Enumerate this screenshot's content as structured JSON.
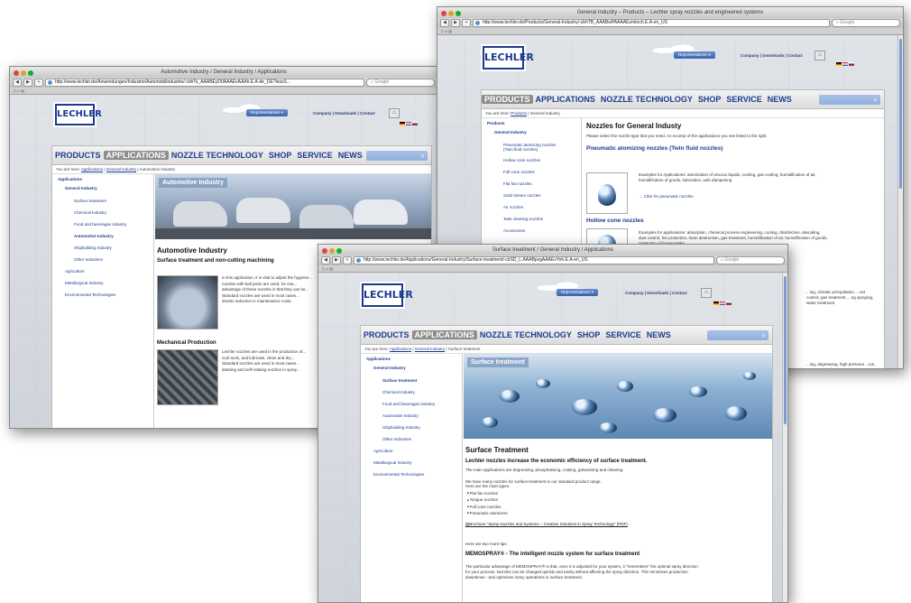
{
  "colors": {
    "brand": "#1c3b8f",
    "nav_active": "#8d8d8d",
    "search": "#9db8e2"
  },
  "icons": {
    "globe": "globe-icon",
    "home": "home-icon",
    "search": "search-icon",
    "back": "back-arrow-icon",
    "forward": "forward-arrow-icon",
    "scroll": "scrollbar"
  },
  "windows": {
    "automotive": {
      "title": "Automotive Industry / General Industry / Applications",
      "url": "http://www.lechler.de/Anwendungen/Industrie/Automobilindustrie/-cbhTs_AAABEyD0AAAEvAAAh.E.A-de_DE?lessS…",
      "google": "Google",
      "logo": "LECHLER",
      "reps": "Representatives",
      "toplinks": "Company | Downloads | Contact",
      "nav": [
        "PRODUCTS",
        "APPLICATIONS",
        "NOZZLE TECHNOLOGY",
        "SHOP",
        "SERVICE",
        "NEWS"
      ],
      "crumb_prefix": "You are here:",
      "crumb": [
        "Applications",
        "General Industry",
        "Automotive Industry"
      ],
      "side": [
        "Applications",
        "General Industry",
        "Surface treatment",
        "Chemical Industry",
        "Food and beverages industry",
        "Automotive Industry",
        "Shipbuilding Industry",
        "Other Industries",
        "Agriculture",
        "Metallurgical Industry",
        "Environmental Technologies"
      ],
      "banner": "Automotive Industry",
      "heading": "Automotive Industry",
      "sub1": "Surface treatment and non-cutting machining",
      "text1a": "In this application, it is vital to adjust the hygiene...",
      "text1b": "nozzles with ball joints are used, for exa...",
      "text1c": "advantage of these nozzles is that they can be...",
      "text1d": "Standard nozzles are used in most cases...",
      "text1e": "drastic reduction in maintenance costs.",
      "sub2": "Mechanical Production",
      "text2a": "Lechler nozzles are used in the production of...",
      "text2b": "cool tools, and lubricate, clean and dry...",
      "text2c": "Standard nozzles are used in most cases...",
      "text2d": "draining and self-rotating nozzles in spray..."
    },
    "products": {
      "title": "General Industry – Products – Lechler spray nozzles and engineered systems",
      "url": "http://www.lechler.de/Products/General-Industry/-cbhTB_AAABwPAAAAEzmtoch.E.A-en_US",
      "google": "Google",
      "logo": "LECHLER",
      "reps": "Representatives",
      "toplinks": "Company | Downloads | Contact",
      "nav": [
        "PRODUCTS",
        "APPLICATIONS",
        "NOZZLE TECHNOLOGY",
        "SHOP",
        "SERVICE",
        "NEWS"
      ],
      "crumb_prefix": "You are here:",
      "crumb": [
        "Products",
        "General Industry"
      ],
      "side": [
        "Products",
        "General Industry",
        "Pneumatic atomizing nozzles (Twin fluid nozzles)",
        "Hollow cone nozzles",
        "Full cone nozzles",
        "Flat fan nozzles",
        "Solid stream nozzles",
        "Air nozzles",
        "Tank cleaning nozzles",
        "Accessories"
      ],
      "heading": "Nozzles for General Industy",
      "intro": "Please select the nozzle type that you need. An excerpt of the applications you see listed to the right.",
      "sec1": "Pneumatic atomizing nozzles (Twin fluid nozzles)",
      "sec1_text": "Examples for Applications: atomization of viscous liquids, cooling, gas cooling, humidification of air, humidification of goods, lubrication, web dampening",
      "sec1_link": "Click for pneumatic nozzles",
      "sec2": "Hollow cone nozzles",
      "sec2_text": "Examples for applications: absorption, chemical process engineering, cooling, disinfection, descaling, dust control, fire protection, foam destruction, gas treatment, humidification of air, humidification of goods, protection of forage tanks...",
      "sec3_text": "...ing, climatic precipitation, ...ust control, gas treatment, ...ng spraying, water treatment",
      "sec4_text": "...ing, degreasing, high pressure ...ion, sun screens, foam control,"
    },
    "surface": {
      "title": "Surface treatment / General Industry / Applications",
      "url": "http://www.lechler.de/Applications/General-Industry/Surface-treatment/-cbSD_L.AAABpxgAAAEvYoh.E.A-en_US",
      "google": "Google",
      "logo": "LECHLER",
      "reps": "Representatives",
      "toplinks": "Company | Downloads | Contact",
      "nav": [
        "PRODUCTS",
        "APPLICATIONS",
        "NOZZLE TECHNOLOGY",
        "SHOP",
        "SERVICE",
        "NEWS"
      ],
      "crumb_prefix": "You are here:",
      "crumb": [
        "Applications",
        "General Industry",
        "Surface treatment"
      ],
      "side": [
        "Applications",
        "General Industry",
        "Surface treatment",
        "Chemical Industry",
        "Food and beverages industry",
        "Automotive Industry",
        "Shipbuilding Industry",
        "Other Industries",
        "Agriculture",
        "Metallurgical Industry",
        "Environmental Technologies"
      ],
      "banner": "Surface treatment",
      "heading": "Surface Treatment",
      "sub1": "Lechler nozzles increase the economic efficiency of surface treatment.",
      "text1": "The main applications are degreasing, phosphatising, coating, galvanising and cleaning.",
      "text2": "We have many nozzles for surface treatment in our standard product range.",
      "text3": "Here are the main types:",
      "bullets": [
        "Flat fan nozzles",
        "Tongue nozzles",
        "Full cone nozzles",
        "Pneumatic atomizers"
      ],
      "brochure": "Brochure \"Spray Nozzles and Systems – Creative Solutions in Spray Technology\" (PDF)",
      "tips": "Here are two more tips:",
      "memo_title": "MEMOSPRAY® - The intelligent nozzle system for surface treatment",
      "memo_text1": "The particular advantage of MEMOSPRAY® is that, once it is adjusted for your system, it \"remembers\" the optimal spray direction",
      "memo_text2": "for your process. Nozzles can be changed quickly and easily without affecting the spray direction. This minimises production",
      "memo_text3": "downtimes - and optimises many operations in surface treatment."
    }
  }
}
